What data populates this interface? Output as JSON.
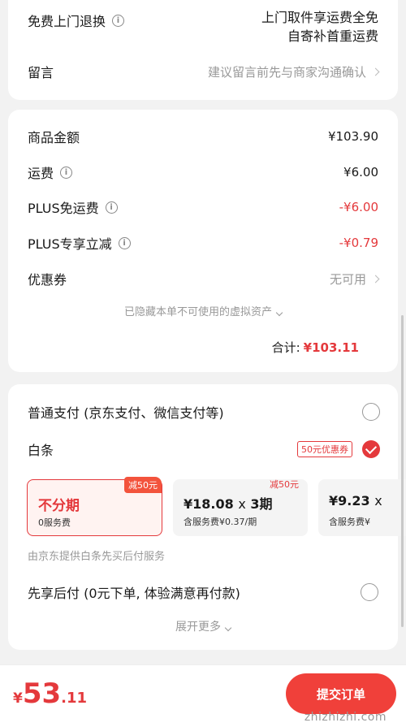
{
  "service": {
    "return_label": "免费上门退换",
    "return_value_line1": "上门取件享运费全免",
    "return_value_line2": "自寄补首重运费",
    "message_label": "留言",
    "message_placeholder": "建议留言前先与商家沟通确认"
  },
  "summary": {
    "goods_label": "商品金额",
    "goods_value": "¥103.90",
    "shipping_label": "运费",
    "shipping_value": "¥6.00",
    "plus_free_label": "PLUS免运费",
    "plus_free_value": "-¥6.00",
    "plus_discount_label": "PLUS专享立减",
    "plus_discount_value": "-¥0.79",
    "coupon_label": "优惠券",
    "coupon_value": "无可用",
    "hidden_assets": "已隐藏本单不可使用的虚拟资产",
    "total_label": "合计:",
    "total_value": "¥103.11"
  },
  "payment": {
    "normal_label": "普通支付 (京东支付、微信支付等)",
    "baitiao_label": "白条",
    "baitiao_coupon": "50元优惠券",
    "plans": [
      {
        "tag": "减50元",
        "main": "不分期",
        "sub": "0服务费"
      },
      {
        "tag": "减50元",
        "main_amount": "¥18.08",
        "main_x": "x",
        "main_terms": "3期",
        "sub": "含服务费¥0.37/期"
      },
      {
        "main_amount": "¥9.23",
        "main_x": "x",
        "sub": "含服务费¥"
      }
    ],
    "baitiao_note": "由京东提供白条先买后付服务",
    "later_label": "先享后付 (0元下单, 体验满意再付款)",
    "expand_more": "展开更多"
  },
  "bottom": {
    "currency": "¥",
    "price_int": "53",
    "price_dec": ".11",
    "submit_label": "提交订单",
    "watermark": "zhizhizhi.com"
  },
  "colors": {
    "accent": "#e4393c",
    "background": "#f2f2f2"
  }
}
